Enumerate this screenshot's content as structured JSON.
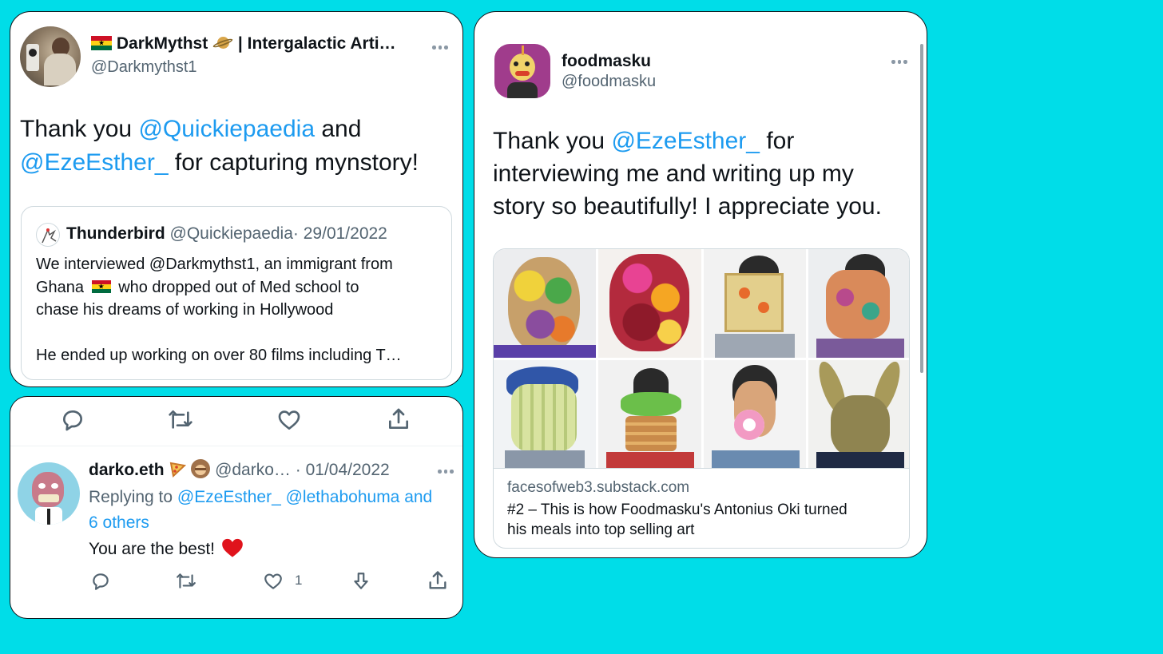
{
  "tweet1": {
    "display_name": "DarkMythst",
    "name_suffix": "| Intergalactic Arti…",
    "handle": "@Darkmythst1",
    "body_prefix": "Thank you",
    "mention1": "@Quickiepaedia",
    "body_mid": "and",
    "mention2": "@EzeEsther_",
    "body_suffix": "for capturing mynstory!",
    "quote": {
      "name": "Thunderbird",
      "handle": "@Quickiepaedia",
      "sep": "·",
      "date": "29/01/2022",
      "line1": "We interviewed @Darkmythst1, an immigrant from",
      "line2a": "Ghana",
      "line2b": "who dropped out of Med school to",
      "line3": "chase his dreams of working in Hollywood",
      "line4": "He ended up working on over 80 films including T…"
    }
  },
  "reply": {
    "display_name": "darko.eth",
    "handle": "@darko…",
    "sep": "·",
    "date": "01/04/2022",
    "replying_prefix": "Replying to",
    "replying_mentions": "@EzeEsther_ @lethabohuma and",
    "replying_others": "6 others",
    "body": "You are the best!",
    "like_count": "1"
  },
  "tweet2": {
    "display_name": "foodmasku",
    "handle": "@foodmasku",
    "body_prefix": "Thank you",
    "mention": "@EzeEsther_",
    "body_line1_suffix": "for",
    "body_line2": "interviewing me and writing up my",
    "body_line3": "story so beautifully! I appreciate you.",
    "link_domain": "facesofweb3.substack.com",
    "link_title_line1": "#2 – This is how Foodmasku's Antonius Oki turned",
    "link_title_line2": "his meals into top selling art"
  },
  "colors": {
    "background": "#00DDE8",
    "link": "#1d9bf0",
    "muted": "#536471"
  }
}
